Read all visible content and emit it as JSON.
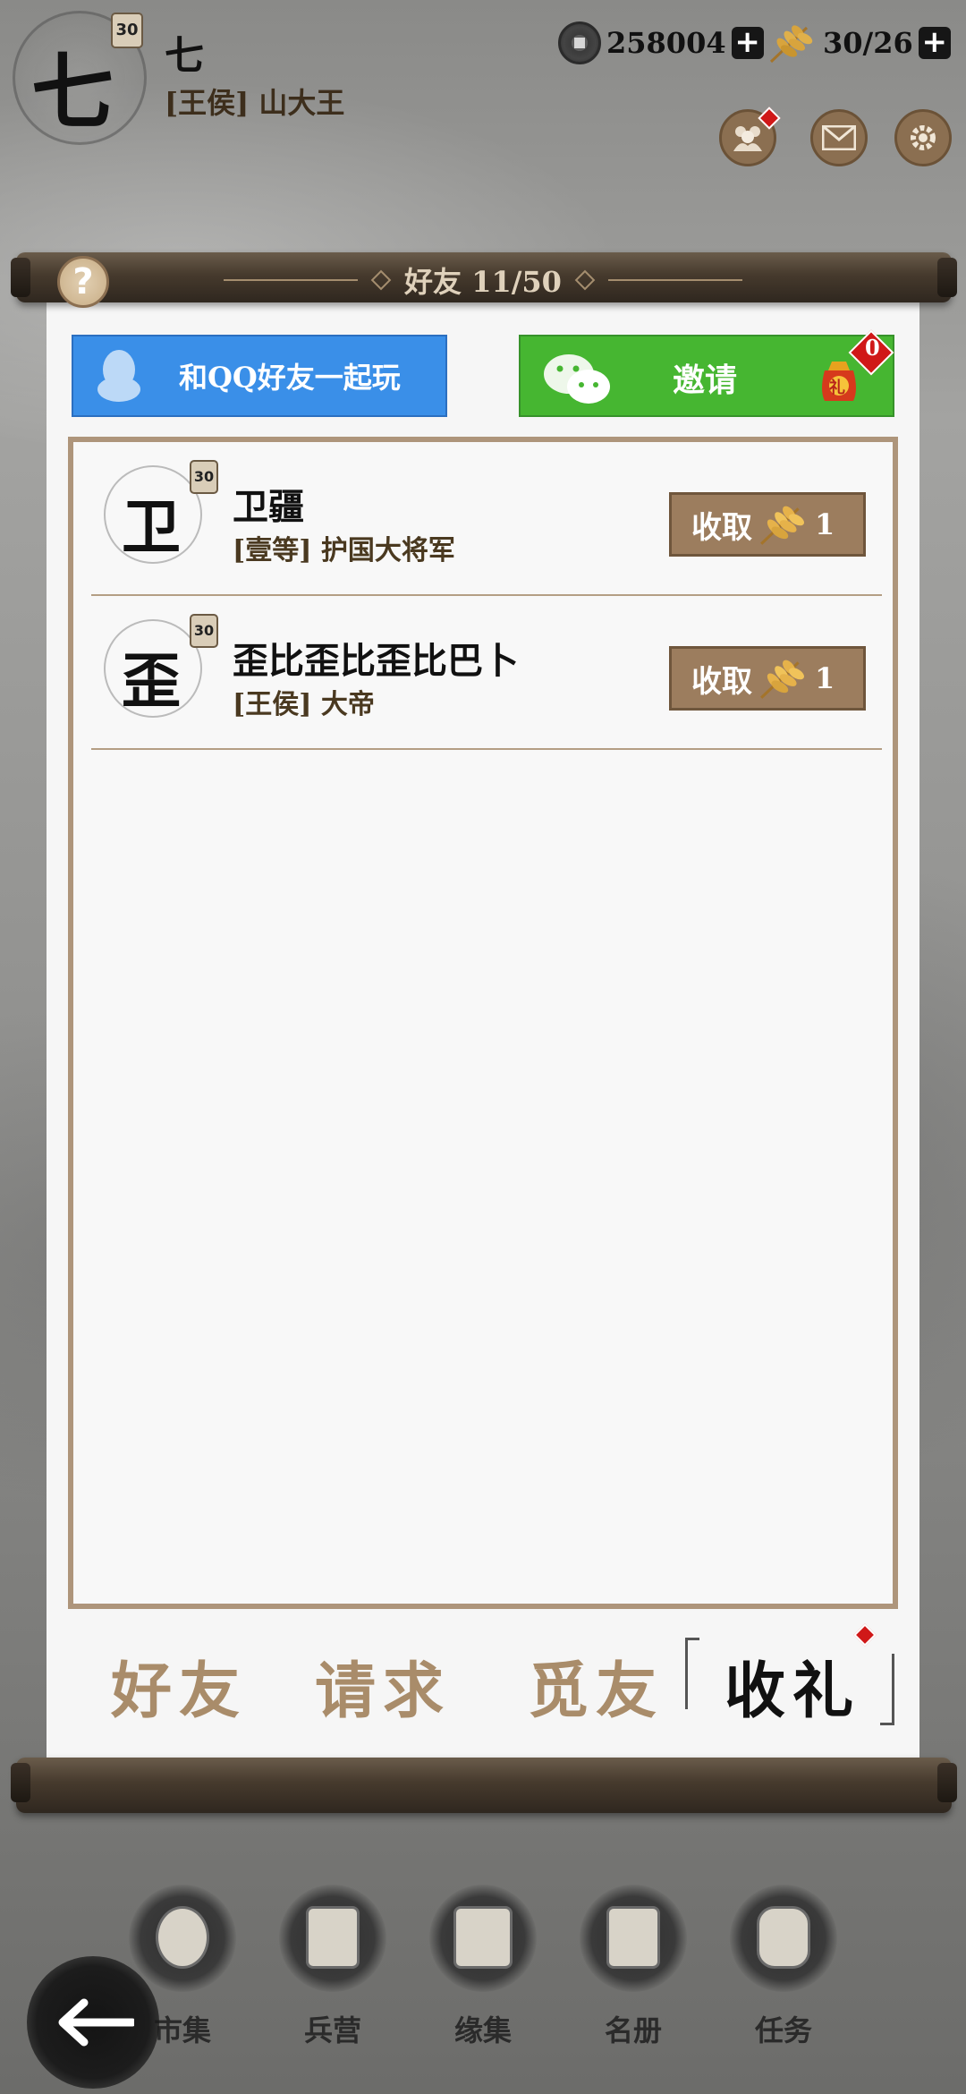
{
  "player": {
    "avatar_char": "七",
    "level": "30",
    "name": "七",
    "title": "[王侯] 山大王"
  },
  "resources": {
    "coins": "258004",
    "grain": "30/26"
  },
  "panel": {
    "title": "好友 11/50",
    "help_symbol": "?"
  },
  "invite": {
    "qq_label": "和QQ好友一起玩",
    "wechat_label": "邀请",
    "gift_badge": "0",
    "gift_char": "礼"
  },
  "friends": [
    {
      "avatar_char": "卫",
      "level": "30",
      "name": "卫疆",
      "rank": "[壹等] 护国大将军",
      "button": "收取",
      "amount": "1"
    },
    {
      "avatar_char": "歪",
      "level": "30",
      "name": "歪比歪比歪比巴卜",
      "rank": "[王侯] 大帝",
      "button": "收取",
      "amount": "1"
    }
  ],
  "tabs": [
    {
      "label": "好友",
      "active": false
    },
    {
      "label": "请求",
      "active": false
    },
    {
      "label": "觅友",
      "active": false
    },
    {
      "label": "收礼",
      "active": true
    }
  ],
  "nav": [
    {
      "label": "市集",
      "icon": "market-icon"
    },
    {
      "label": "兵营",
      "icon": "barracks-icon"
    },
    {
      "label": "缘集",
      "icon": "fate-book-icon"
    },
    {
      "label": "名册",
      "icon": "roster-icon"
    },
    {
      "label": "任务",
      "icon": "task-scroll-icon"
    }
  ],
  "colors": {
    "qq_blue": "#3a8fe8",
    "wechat_green": "#46b631",
    "collect_brown": "#9c7d5e",
    "tab_inactive": "#a98c6a",
    "notice_red": "#d01818"
  }
}
